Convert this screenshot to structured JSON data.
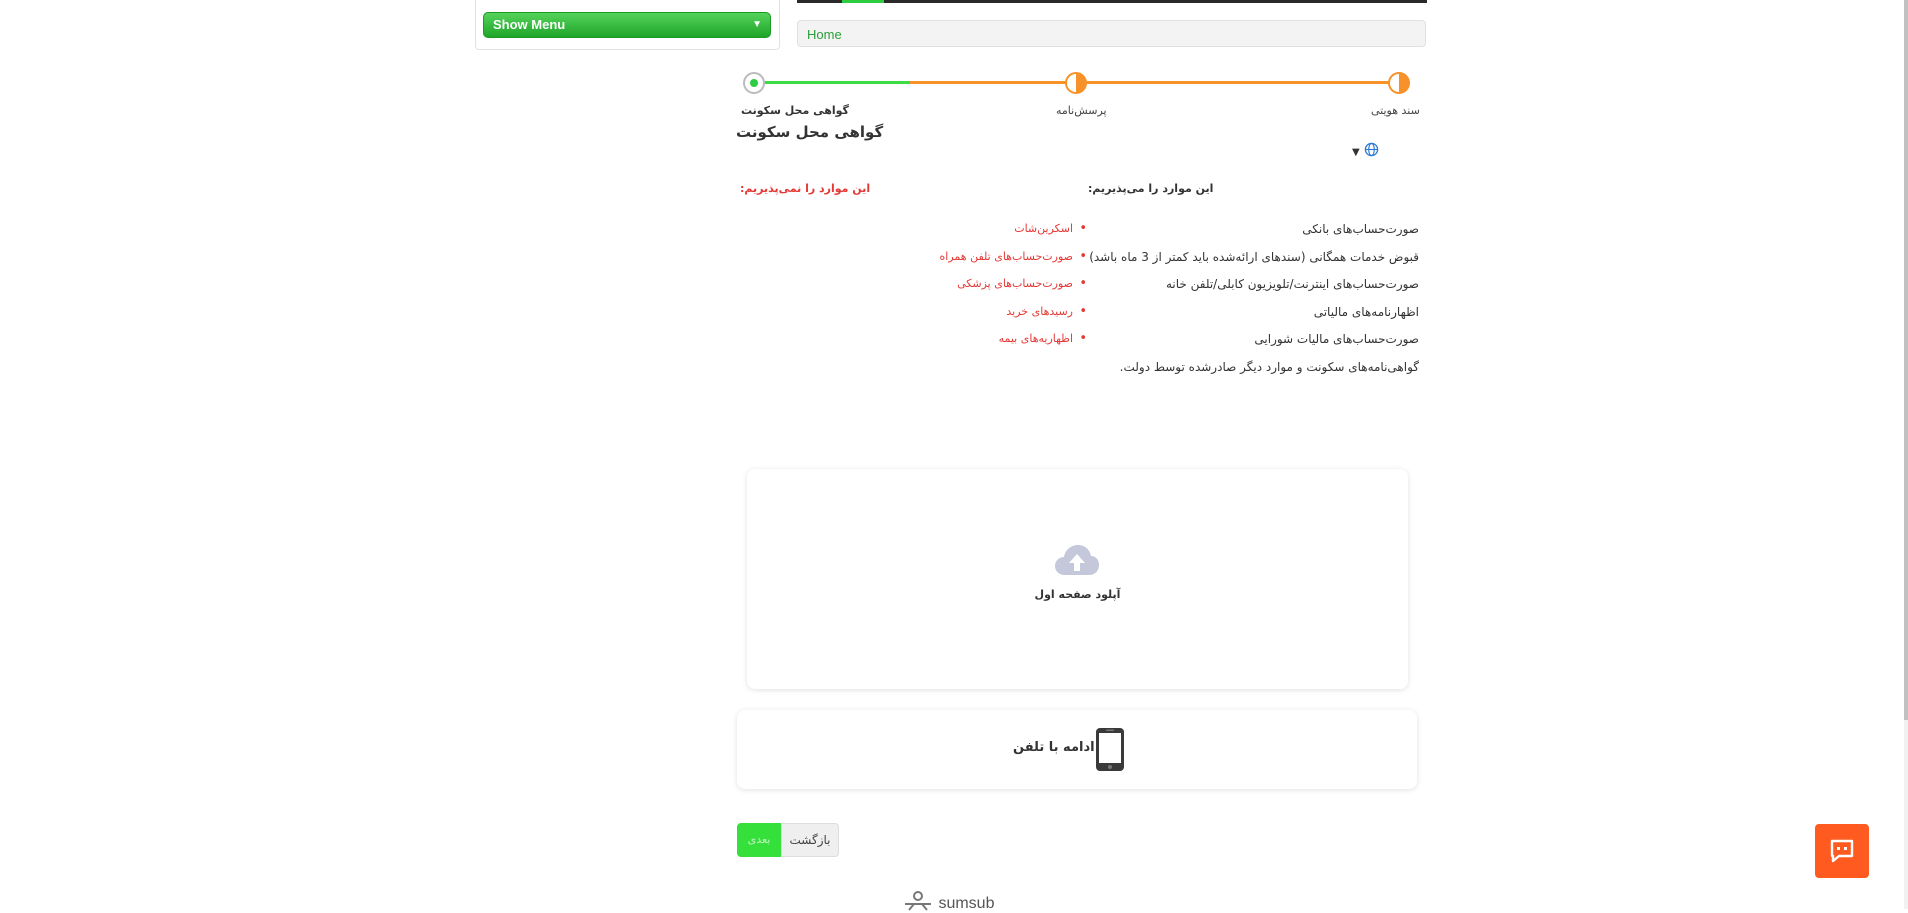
{
  "menu": {
    "label": "Show Menu",
    "arrow": "▼"
  },
  "breadcrumb": {
    "home": "Home"
  },
  "steps": [
    {
      "label": "گواهی محل سکونت",
      "state": "current"
    },
    {
      "label": "پرسش‌نامه",
      "state": "partial"
    },
    {
      "label": "سند هویتی",
      "state": "partial"
    }
  ],
  "document": {
    "title": "گواهی محل سکونت"
  },
  "language": {
    "icon": "globe-icon",
    "arrow": "▼"
  },
  "accepted": {
    "heading": "این موارد را می‌پذیریم:",
    "items": [
      "صورت‌حساب‌های بانکی",
      "قبوض خدمات همگانی (سندهای ارائه‌شده باید کمتر از 3 ماه باشد)",
      "صورت‌حساب‌های اینترنت/تلویزیون کابلی/تلفن خانه",
      "اظهارنامه‌های مالیاتی",
      "صورت‌حساب‌های مالیات شورایی",
      "گواهی‌نامه‌های سکونت و موارد دیگر صادرشده توسط دولت."
    ]
  },
  "rejected": {
    "heading": "این موارد را نمی‌پذیریم:",
    "items": [
      "اسکرین‌شات",
      "صورت‌حساب‌های تلفن همراه",
      "صورت‌حساب‌های پزشکی",
      "رسیدهای خرید",
      "اظهاریه‌های بیمه"
    ]
  },
  "upload": {
    "label": "آپلود صفحه اول",
    "icon": "cloud-upload-icon"
  },
  "phone": {
    "label": "ادامه با تلفن",
    "icon": "phone-icon"
  },
  "buttons": {
    "back": "بازگشت",
    "next": "بعدی"
  },
  "brand": {
    "name": "sumsub"
  },
  "colors": {
    "accent_green": "#2ecc40",
    "accent_orange": "#f7922a",
    "danger": "#e53935",
    "chat": "#ff5a1f"
  }
}
